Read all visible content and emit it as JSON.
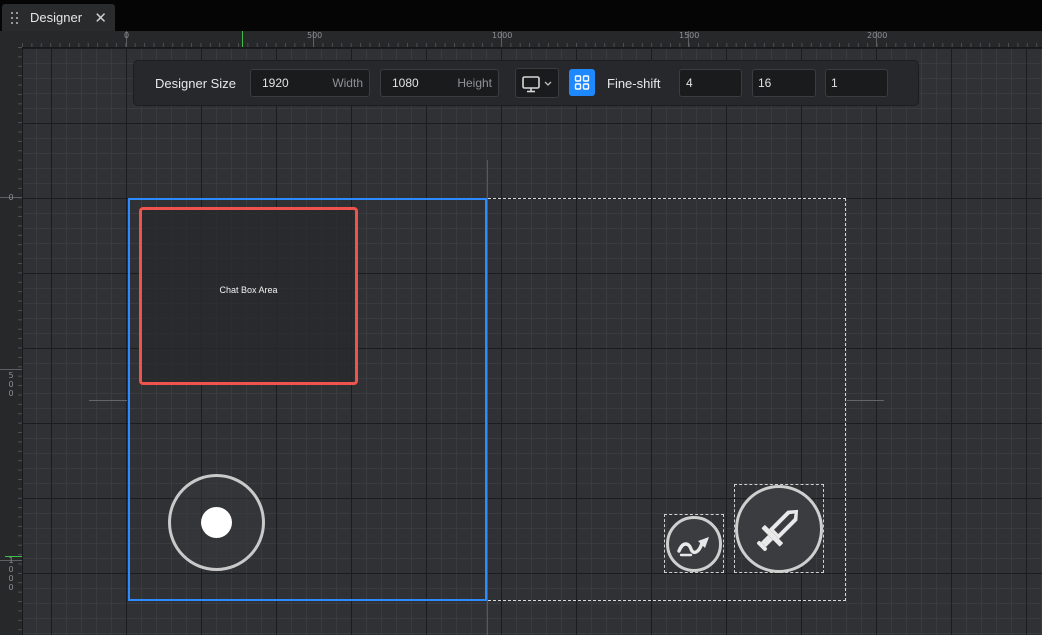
{
  "tab": {
    "title": "Designer",
    "grip_icon": "drag-grip-icon",
    "close_icon": "close-icon"
  },
  "ruler": {
    "top_labels": [
      "0",
      "500",
      "1000",
      "1500",
      "2000"
    ],
    "left_labels": [
      [
        "0"
      ],
      [
        "5",
        "0",
        "0"
      ],
      [
        "1",
        "0",
        "0",
        "0"
      ]
    ]
  },
  "toolbar": {
    "designer_size_label": "Designer Size",
    "width_value": "1920",
    "width_unit": "Width",
    "height_value": "1080",
    "height_unit": "Height",
    "device_icon": "monitor-icon",
    "grid_icon": "grid-icon",
    "fine_shift_label": "Fine-shift",
    "fine_shift_values": [
      "4",
      "16",
      "1"
    ]
  },
  "canvas": {
    "chatbox_label": "Chat Box Area",
    "joystick_icon": "joystick-icon",
    "dodge_icon": "dodge-arrow-icon",
    "attack_icon": "sword-icon"
  },
  "colors": {
    "selection_blue": "#2d8bff",
    "chatbox_red": "#f0524d",
    "accent_button": "#1e88ff",
    "ruler_marker_green": "#3fbf4a"
  }
}
